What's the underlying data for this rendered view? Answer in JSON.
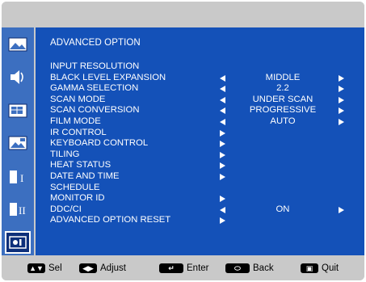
{
  "osd": {
    "title": "ADVANCED OPTION",
    "sidebar": {
      "icons": [
        {
          "name": "picture-icon",
          "active": false
        },
        {
          "name": "audio-icon",
          "active": false
        },
        {
          "name": "pip-icon",
          "active": false
        },
        {
          "name": "screen-icon",
          "active": false
        },
        {
          "name": "setup1-icon",
          "active": false
        },
        {
          "name": "setup2-icon",
          "active": false
        },
        {
          "name": "advanced-option-icon",
          "active": true
        }
      ]
    },
    "items": [
      {
        "label": "INPUT RESOLUTION",
        "left_arrow": false,
        "right_arrow": false,
        "value": ""
      },
      {
        "label": "BLACK LEVEL EXPANSION",
        "left_arrow": true,
        "right_arrow": true,
        "value": "MIDDLE"
      },
      {
        "label": "GAMMA SELECTION",
        "left_arrow": true,
        "right_arrow": true,
        "value": "2.2"
      },
      {
        "label": "SCAN MODE",
        "left_arrow": true,
        "right_arrow": true,
        "value": "UNDER SCAN"
      },
      {
        "label": "SCAN CONVERSION",
        "left_arrow": true,
        "right_arrow": true,
        "value": "PROGRESSIVE"
      },
      {
        "label": "FILM MODE",
        "left_arrow": true,
        "right_arrow": true,
        "value": "AUTO"
      },
      {
        "label": "IR CONTROL",
        "submenu_arrow": true,
        "value": ""
      },
      {
        "label": "KEYBOARD CONTROL",
        "submenu_arrow": true,
        "value": ""
      },
      {
        "label": "TILING",
        "submenu_arrow": true,
        "value": ""
      },
      {
        "label": "HEAT STATUS",
        "submenu_arrow": true,
        "value": ""
      },
      {
        "label": "DATE AND TIME",
        "submenu_arrow": true,
        "value": ""
      },
      {
        "label": "SCHEDULE",
        "submenu_arrow": false,
        "value": ""
      },
      {
        "label": "MONITOR ID",
        "submenu_arrow": true,
        "value": ""
      },
      {
        "label": "DDC/CI",
        "left_arrow": true,
        "right_arrow": true,
        "value": "ON"
      },
      {
        "label": "ADVANCED OPTION RESET",
        "submenu_arrow": true,
        "value": ""
      }
    ],
    "footer": {
      "sel": {
        "key": "▲▼",
        "label": "Sel"
      },
      "adjust": {
        "key": "◀▶",
        "label": "Adjust"
      },
      "enter": {
        "key": "↵",
        "label": "Enter"
      },
      "back": {
        "key": "⬭",
        "label": "Back"
      },
      "quit": {
        "key": "▣",
        "label": "Quit"
      }
    },
    "colors": {
      "panel": "#1451b8",
      "sidebar": "#3c6fc0",
      "frame": "#c9c9c9",
      "text": "#ffffff"
    }
  }
}
